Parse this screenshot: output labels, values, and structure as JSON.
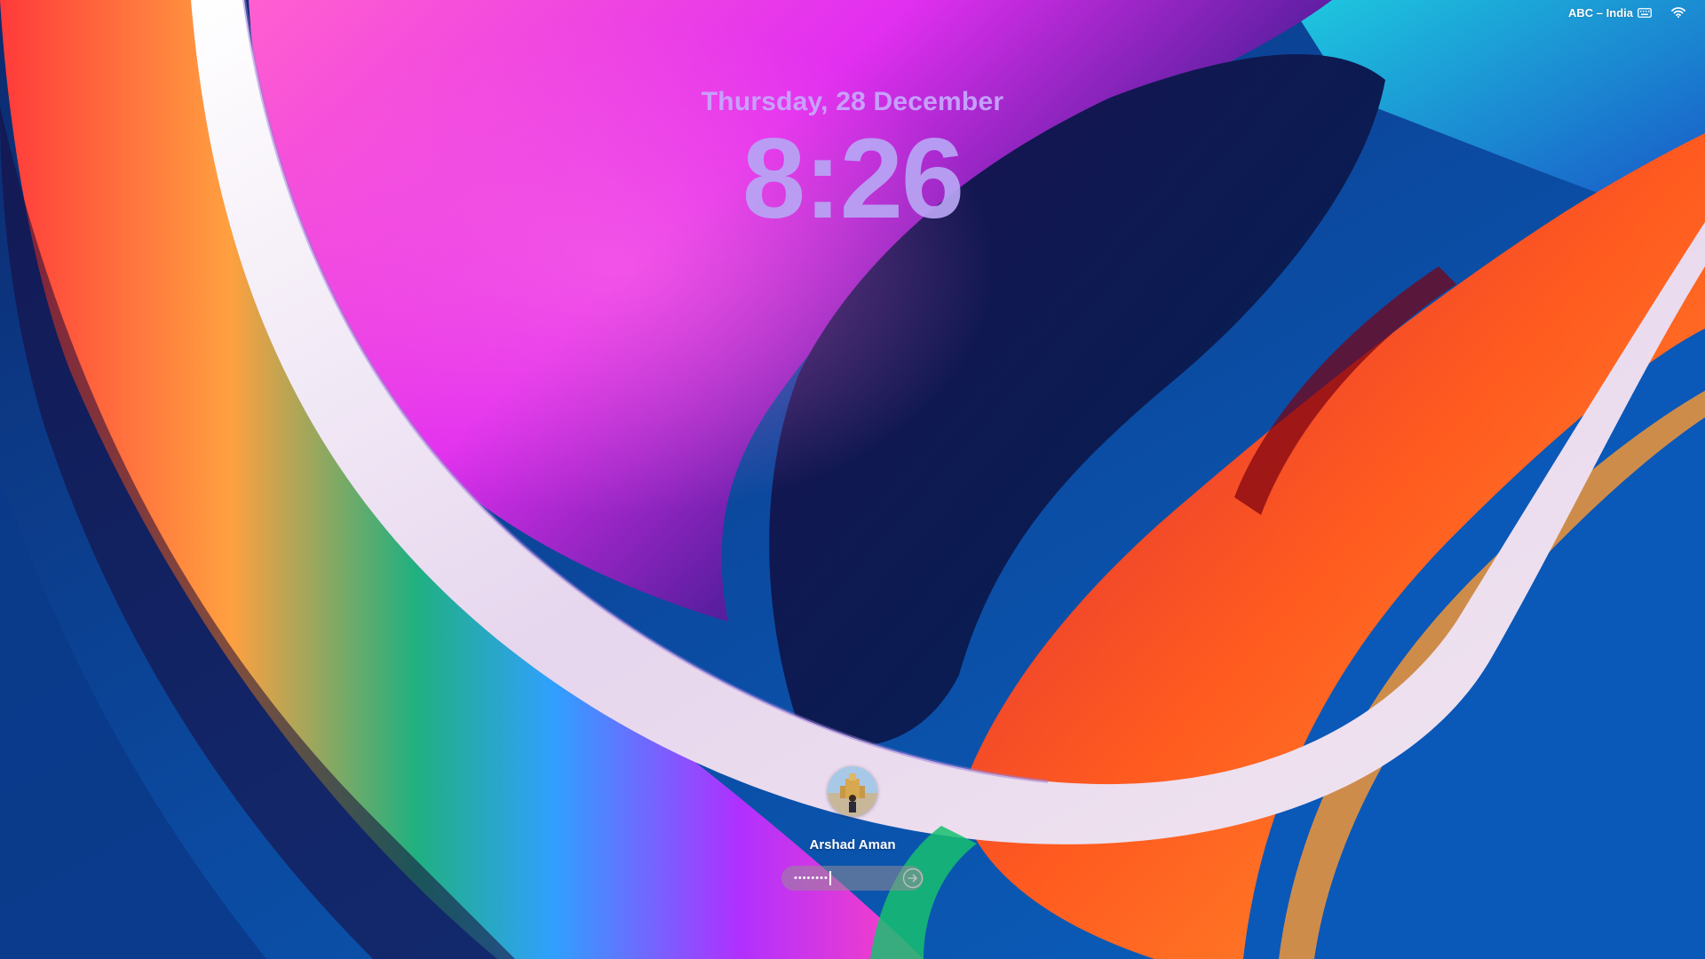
{
  "status_bar": {
    "input_source_label": "ABC – India",
    "icons": [
      "keyboard-icon",
      "wifi-icon"
    ]
  },
  "lock_screen": {
    "date": "Thursday, 28 December",
    "time": "8:26"
  },
  "login": {
    "user_name": "Arshad Aman",
    "password_dots": "••••••••",
    "submit_icon": "arrow-right-circle-icon"
  },
  "colors": {
    "date_text": "#c7a6ff",
    "time_text": "#b8a5f5",
    "field_background": "#968c96"
  }
}
